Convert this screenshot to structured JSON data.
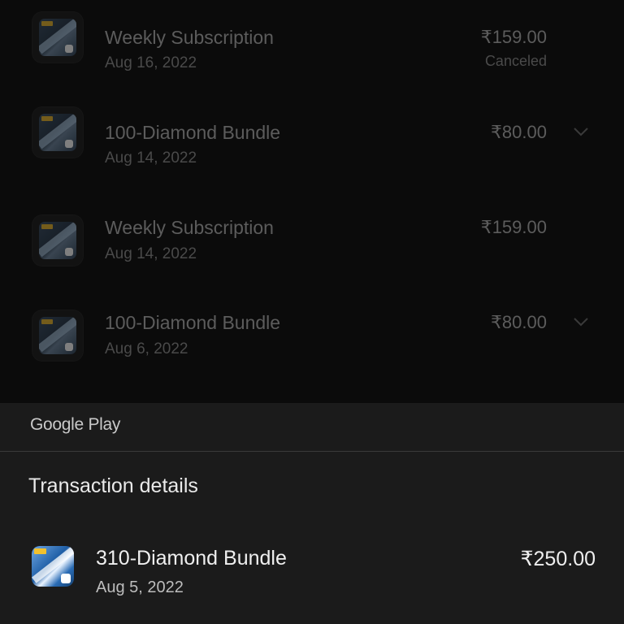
{
  "history": {
    "items": [
      {
        "title": "Weekly Subscription",
        "date": "Aug 16, 2022",
        "price": "₹159.00",
        "status": "Canceled",
        "expandable": false
      },
      {
        "title": "100-Diamond Bundle",
        "date": "Aug 14, 2022",
        "price": "₹80.00",
        "status": "",
        "expandable": true
      },
      {
        "title": "Weekly Subscription",
        "date": "Aug 14, 2022",
        "price": "₹159.00",
        "status": "",
        "expandable": false
      },
      {
        "title": "100-Diamond Bundle",
        "date": "Aug 6, 2022",
        "price": "₹80.00",
        "status": "",
        "expandable": true
      }
    ]
  },
  "sheet": {
    "brand": "Google Play",
    "title": "Transaction details",
    "transaction": {
      "name": "310-Diamond Bundle",
      "date": "Aug 5, 2022",
      "price": "₹250.00"
    }
  },
  "icons": {
    "app_icon": "game-app-icon",
    "chevron": "chevron-down-icon"
  },
  "colors": {
    "background": "#0b0b0b",
    "sheet": "#1b1b1b",
    "divider": "#3a3a3a"
  }
}
